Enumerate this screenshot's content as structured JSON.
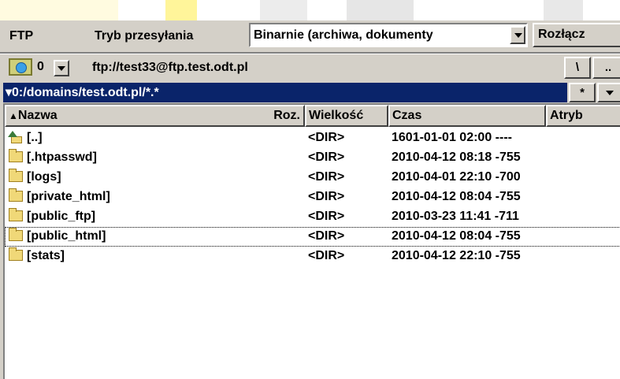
{
  "toolbar": {
    "ftp_label": "FTP",
    "transfer_mode_label": "Tryb przesyłania",
    "transfer_mode_value": "Binarnie (archiwa, dokumenty",
    "disconnect_label": "Rozłącz"
  },
  "drive_bar": {
    "drive_number": "0",
    "connection_path": "ftp://test33@ftp.test.odt.pl",
    "root_button": "\\",
    "up_button": ".."
  },
  "directory_bar": {
    "path": "▾0:/domains/test.odt.pl/*.*",
    "filter_button": "*"
  },
  "file_list": {
    "columns": {
      "name": "Nazwa",
      "ext": "Roz.",
      "size": "Wielkość",
      "time": "Czas",
      "attr": "Atryb"
    },
    "rows": [
      {
        "name": "[..]",
        "size": "<DIR>",
        "time": "1601-01-01 02:00 ----",
        "icon": "up-folder-icon"
      },
      {
        "name": "[.htpasswd]",
        "size": "<DIR>",
        "time": "2010-04-12 08:18 -755",
        "icon": "folder-icon"
      },
      {
        "name": "[logs]",
        "size": "<DIR>",
        "time": "2010-04-01 22:10 -700",
        "icon": "folder-icon"
      },
      {
        "name": "[private_html]",
        "size": "<DIR>",
        "time": "2010-04-12 08:04 -755",
        "icon": "folder-icon"
      },
      {
        "name": "[public_ftp]",
        "size": "<DIR>",
        "time": "2010-03-23 11:41 -711",
        "icon": "folder-icon"
      },
      {
        "name": "[public_html]",
        "size": "<DIR>",
        "time": "2010-04-12 08:04 -755",
        "icon": "folder-icon"
      },
      {
        "name": "[stats]",
        "size": "<DIR>",
        "time": "2010-04-12 22:10 -755",
        "icon": "folder-icon"
      }
    ]
  },
  "colors": {
    "window_bg": "#d4d0c8",
    "active_path_bg": "#0a246a",
    "folder_yellow": "#f0d878"
  }
}
